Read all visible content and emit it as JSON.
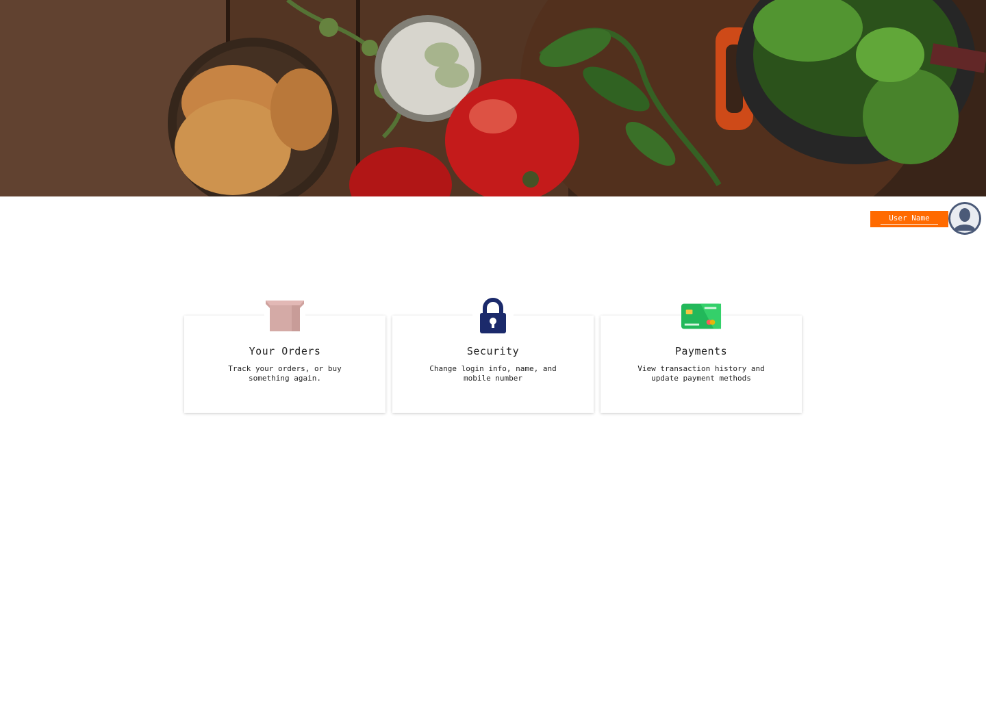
{
  "hero": {
    "icon": "food-banner-image"
  },
  "user": {
    "name": "User Name",
    "avatar_icon": "user-avatar-icon"
  },
  "cards": [
    {
      "title": "Your Orders",
      "description": "Track your orders, or buy something again.",
      "icon": "box-icon"
    },
    {
      "title": "Security",
      "description": "Change login info, name, and mobile number",
      "icon": "lock-icon"
    },
    {
      "title": "Payments",
      "description": "View transaction history and update payment methods",
      "icon": "credit-card-icon"
    }
  ],
  "colors": {
    "accent": "#ff6a00",
    "lock": "#1b2a6b",
    "card_green": "#2ecc71"
  }
}
